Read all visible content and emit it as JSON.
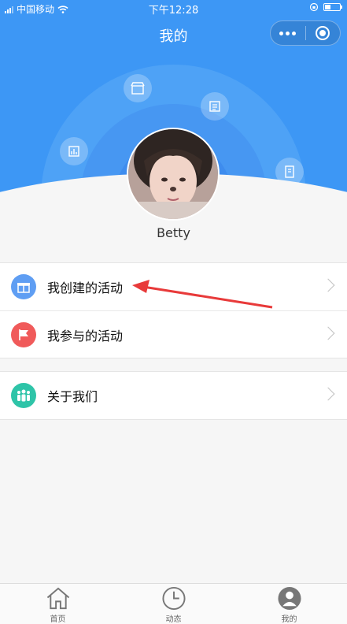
{
  "status": {
    "carrier": "中国移动",
    "time": "下午12:28"
  },
  "header": {
    "title": "我的"
  },
  "profile": {
    "username": "Betty"
  },
  "menu_group1": [
    {
      "label": "我创建的活动",
      "icon": "gift-icon",
      "color": "#5f9ef3"
    },
    {
      "label": "我参与的活动",
      "icon": "flag-icon",
      "color": "#f05a5a"
    }
  ],
  "menu_group2": [
    {
      "label": "关于我们",
      "icon": "people-icon",
      "color": "#2ec4a8"
    }
  ],
  "tabs": [
    {
      "label": "首页",
      "icon": "home-icon"
    },
    {
      "label": "动态",
      "icon": "clock-icon"
    },
    {
      "label": "我的",
      "icon": "user-icon",
      "active": true
    }
  ],
  "colors": {
    "brand": "#3d97f5",
    "annotation_arrow": "#e83a3a"
  }
}
